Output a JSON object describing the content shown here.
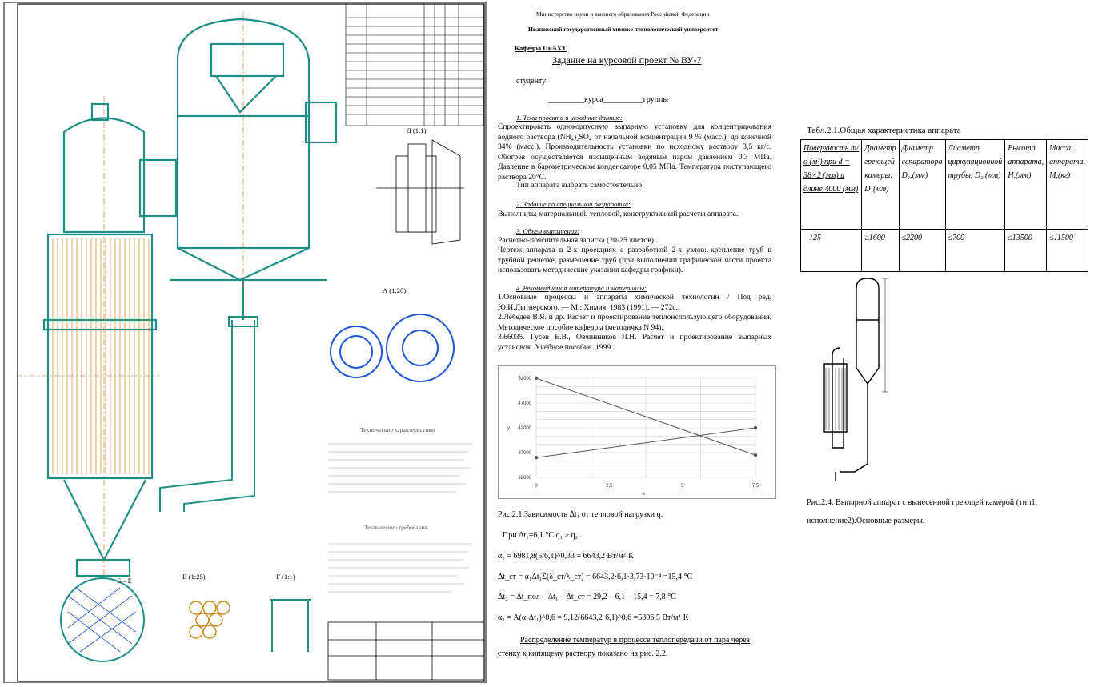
{
  "drawing": {
    "section_label_a": "А (1:20)",
    "section_label_d": "Д (1:1)",
    "section_label_v": "В (1:25)",
    "section_label_g": "Г (1:1)",
    "section_label_e": "Е – Е",
    "tech_title": "Технические характеристики",
    "tech_title2": "Технические требования"
  },
  "assignment": {
    "ministry": "Министерство науки и высшего образования Российской Федерации",
    "university": "Ивановский государственный химико-технологический университет",
    "department": "Кафедра ПиАХТ",
    "title": "Задание на курсовой проект № ВУ-7",
    "student": "студенту:",
    "course_group": "_________курса__________группы",
    "s1_title": "1. Тема проекта и исходные данные:",
    "s1_text": "Спроектировать однокорпусную выпарную установку для концентрирования водного раствора (NH₄)₂SO₄ от начальной концентрации 9 % (масс.), до конечной 34% (масс.). Производительность установки по исходному раствору 3,5 кг/с. Обогрев осуществляется насыщенным водяным паром давлением 0,3 МПа. Давление в барометрическом конденсаторе 0,05 МПа. Температура поступающего раствора 20°С.",
    "s1_type": "Тип аппарата выбрать самостоятельно.",
    "s2_title": "2. Задание по специальной разработке:",
    "s2_text": "Выполнить: материальный, тепловой, конструктивный расчеты аппарата.",
    "s3_title": "3. Объем выполнения:",
    "s3_text1": "Расчетно-пояснительная записка (20-25 листов).",
    "s3_text2": "Чертеж аппарата в 2-х проекциях с разработкой 2-х узлов: крепление труб в трубной решетке, размещение труб (при выполнении графической части проекта использовать методические указания кафедры графики).",
    "s4_title": "4. Рекомендуемая литература и материалы:",
    "s4_text1": "1.Основные процессы и аппараты химической технологии / Под ред. Ю.И.Дытнерского. — М.: Химия, 1983 (1991). — 272с..",
    "s4_text2": "2.Лебедев В.Я. и др. Расчет и проектирование теплоиспользующего оборудования. Методическое пособие кафедры (методичка N 94).",
    "s4_text3": "3.66035. Гусев Е.В., Овчинников Л.Н. Расчет и проектирование выпарных установок. Учебное пособие. 1999."
  },
  "chart_data": {
    "type": "line",
    "title": "",
    "xlabel": "x",
    "ylabel": "y",
    "y_ticks": [
      "52000",
      "47000",
      "42000",
      "37000",
      "32000"
    ],
    "x_ticks": [
      "0",
      "2,5",
      "5",
      "7,5"
    ],
    "series": [
      {
        "values": [
          [
            0,
            52000
          ],
          [
            7.5,
            36500
          ]
        ]
      },
      {
        "values": [
          [
            0,
            36000
          ],
          [
            7.5,
            42000
          ]
        ]
      }
    ],
    "ylim": [
      32000,
      52000
    ],
    "xlim": [
      0,
      7.5
    ],
    "grid": true
  },
  "formulas": {
    "caption": "Рис.2.1.Зависимость Δt₁ от тепловой нагрузки q.",
    "line1": "При Δt₁=6,1 °С  q₁ ≥ q₂ .",
    "line2": "α₁ = 6981,8(5/6,1)^0,33 = 6643,2 Вт/м²·К",
    "line3": "Δt_ст = α₁Δt₁Σ(δ_ст/λ_ст) = 6643,2·6,1·3,73·10⁻⁴ =15,4 °С",
    "line4": "Δt₂ = Δt_пол – Δt₁ – Δt_ст = 29,2 – 6,1 – 15,4 = 7,8 °С",
    "line5": "α₂ = A(α₁Δt₁)^0,6 = 9,12(6643,2·6,1)^0,6 =5306,5 Вт/м²·К",
    "line6": "Распределение температур в процессе теплопередачи от пара через",
    "line7": "стенку к кипящему раствору показано на рис. 2.2."
  },
  "spec_table": {
    "title": "Табл.2.1.Общая характеристика аппарата",
    "headers": [
      "Поверхность т/о (м²) при d = 38×2 (мм) и длине 4000 (мм)",
      "Диаметр греющей камеры, D₁(мм)",
      "Диаметр сепаратора D₁,(мм)",
      "Диаметр циркуляционной трубы, D₂,(мм)",
      "Высота аппарата, H,(мм)",
      "Масса аппарата, М,(кг)"
    ],
    "row": [
      "125",
      "≥1600",
      "≤2200",
      "≤700",
      "≤13500",
      "≤11500"
    ]
  },
  "sketch": {
    "caption": "Рис.2.4. Выпарной аппарат с вынесенной греющей камерой (тип1, исполнение2).Основные размеры."
  }
}
